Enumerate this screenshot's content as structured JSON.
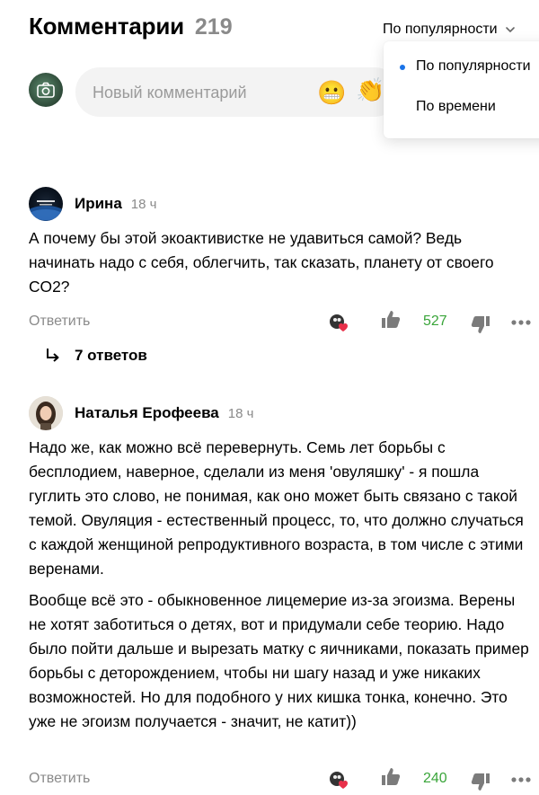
{
  "header": {
    "title": "Комментарии",
    "count": "219"
  },
  "sort": {
    "current": "По популярности",
    "options": [
      {
        "label": "По популярности",
        "selected": true
      },
      {
        "label": "По времени",
        "selected": false
      }
    ]
  },
  "composer": {
    "placeholder": "Новый комментарий",
    "emoji_1": "😬",
    "emoji_2": "👏"
  },
  "colors": {
    "accent_blue": "#1a73e8",
    "likes_green": "#3aa53a",
    "muted_gray": "#8a8a8a",
    "input_bg": "#f3f3f3"
  },
  "comments": [
    {
      "author": "Ирина",
      "time": "18 ч",
      "paragraphs": [
        "А почему бы этой экоактивистке не удавиться самой? Ведь начинать надо с себя, облегчить, так сказать, планету от своего CO2?"
      ],
      "reply_label": "Ответить",
      "likes": "527",
      "replies_label": "7 ответов"
    },
    {
      "author": "Наталья Ерофеева",
      "time": "18 ч",
      "paragraphs": [
        "Надо же, как можно всё перевернуть. Семь лет борьбы с бесплодием, наверное, сделали из меня 'овуляшку' - я пошла гуглить это слово, не понимая, как оно может быть связано с такой темой. Овуляция - естественный процесс, то, что должно случаться с каждой женщиной репродуктивного возраста, в том числе с этими веренами.",
        "Вообще всё это - обыкновенное лицемерие из-за эгоизма. Верены не хотят заботиться о детях, вот и придумали себе теорию. Надо было пойти дальше и вырезать матку с яичниками, показать пример борьбы с деторождением, чтобы ни шагу назад и уже никаких возможностей. Но для подобного у них кишка тонка, конечно. Это уже не эгоизм получается - значит, не катит))"
      ],
      "reply_label": "Ответить",
      "likes": "240"
    }
  ]
}
